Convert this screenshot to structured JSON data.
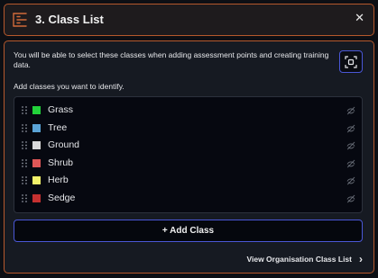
{
  "header": {
    "title": "3. Class List",
    "close_glyph": "✕",
    "accent": "#b5582c"
  },
  "panel": {
    "description": "You will be able to select these classes when adding assessment points and creating training data.",
    "subheading": "Add classes you want to identify."
  },
  "classes": [
    {
      "label": "Grass",
      "color": "#22d13a"
    },
    {
      "label": "Tree",
      "color": "#5aa3d6"
    },
    {
      "label": "Ground",
      "color": "#d9d9d9"
    },
    {
      "label": "Shrub",
      "color": "#e05757"
    },
    {
      "label": "Herb",
      "color": "#f2f26a"
    },
    {
      "label": "Sedge",
      "color": "#c53030"
    }
  ],
  "add_button": {
    "label": "+ Add Class"
  },
  "view_link": {
    "label": "View Organisation Class List",
    "chevron": "›"
  },
  "icons": {
    "header": "list-icon",
    "pick": "scan-target-icon",
    "row_handle": "drag-handle-icon",
    "row_visibility": "eye-off-icon"
  }
}
